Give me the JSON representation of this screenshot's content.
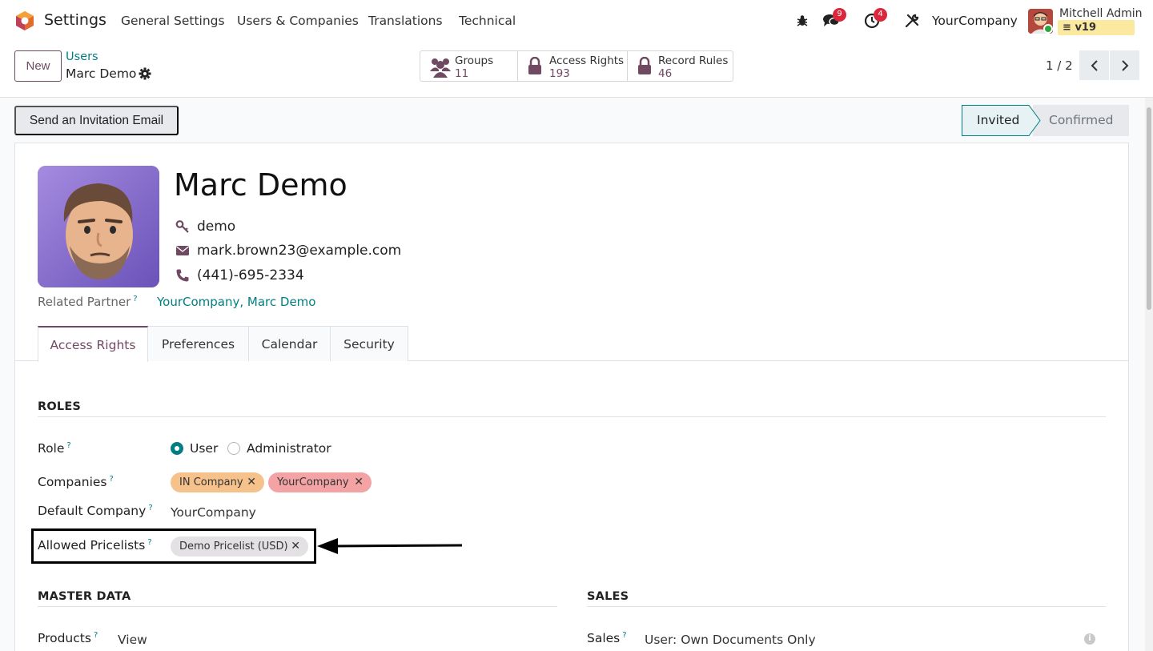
{
  "navbar": {
    "app_name": "Settings",
    "menus": [
      "General Settings",
      "Users & Companies",
      "Translations",
      "Technical"
    ],
    "messages_count": "9",
    "activities_count": "4",
    "company": "YourCompany",
    "user_name": "Mitchell Admin",
    "db_name": "v19"
  },
  "control": {
    "new_label": "New",
    "breadcrumb_parent": "Users",
    "breadcrumb_current": "Marc Demo",
    "smart_buttons": [
      {
        "label": "Groups",
        "value": "11",
        "icon": "users-icon"
      },
      {
        "label": "Access Rights",
        "value": "193",
        "icon": "lock-icon"
      },
      {
        "label": "Record Rules",
        "value": "46",
        "icon": "lock-icon"
      }
    ],
    "pager": "1 / 2"
  },
  "statusbar": {
    "invite_label": "Send an Invitation Email",
    "stages": [
      "Invited",
      "Confirmed"
    ],
    "active_stage": "Invited"
  },
  "record": {
    "name": "Marc Demo",
    "login": "demo",
    "email": "mark.brown23@example.com",
    "phone": "(441)-695-2334",
    "related_partner_label": "Related Partner",
    "related_partner": "YourCompany, Marc Demo",
    "help_mark": "?"
  },
  "tabs": [
    "Access Rights",
    "Preferences",
    "Calendar",
    "Security"
  ],
  "roles": {
    "title": "ROLES",
    "role_label": "Role",
    "role_options": [
      "User",
      "Administrator"
    ],
    "role_selected": "User",
    "companies_label": "Companies",
    "companies": [
      {
        "name": "IN Company",
        "color": "#f6c28b"
      },
      {
        "name": "YourCompany",
        "color": "#f3a3a3"
      }
    ],
    "default_company_label": "Default Company",
    "default_company": "YourCompany",
    "pricelists_label": "Allowed Pricelists",
    "pricelists": [
      "Demo Pricelist (USD)"
    ]
  },
  "master_data": {
    "title": "MASTER DATA",
    "products_label": "Products",
    "products_value": "View"
  },
  "sales": {
    "title": "SALES",
    "sales_label": "Sales",
    "sales_value": "User: Own Documents Only"
  },
  "colors": {
    "brand": "#6f4a62",
    "link": "#017e84",
    "badge": "#d9283b"
  }
}
